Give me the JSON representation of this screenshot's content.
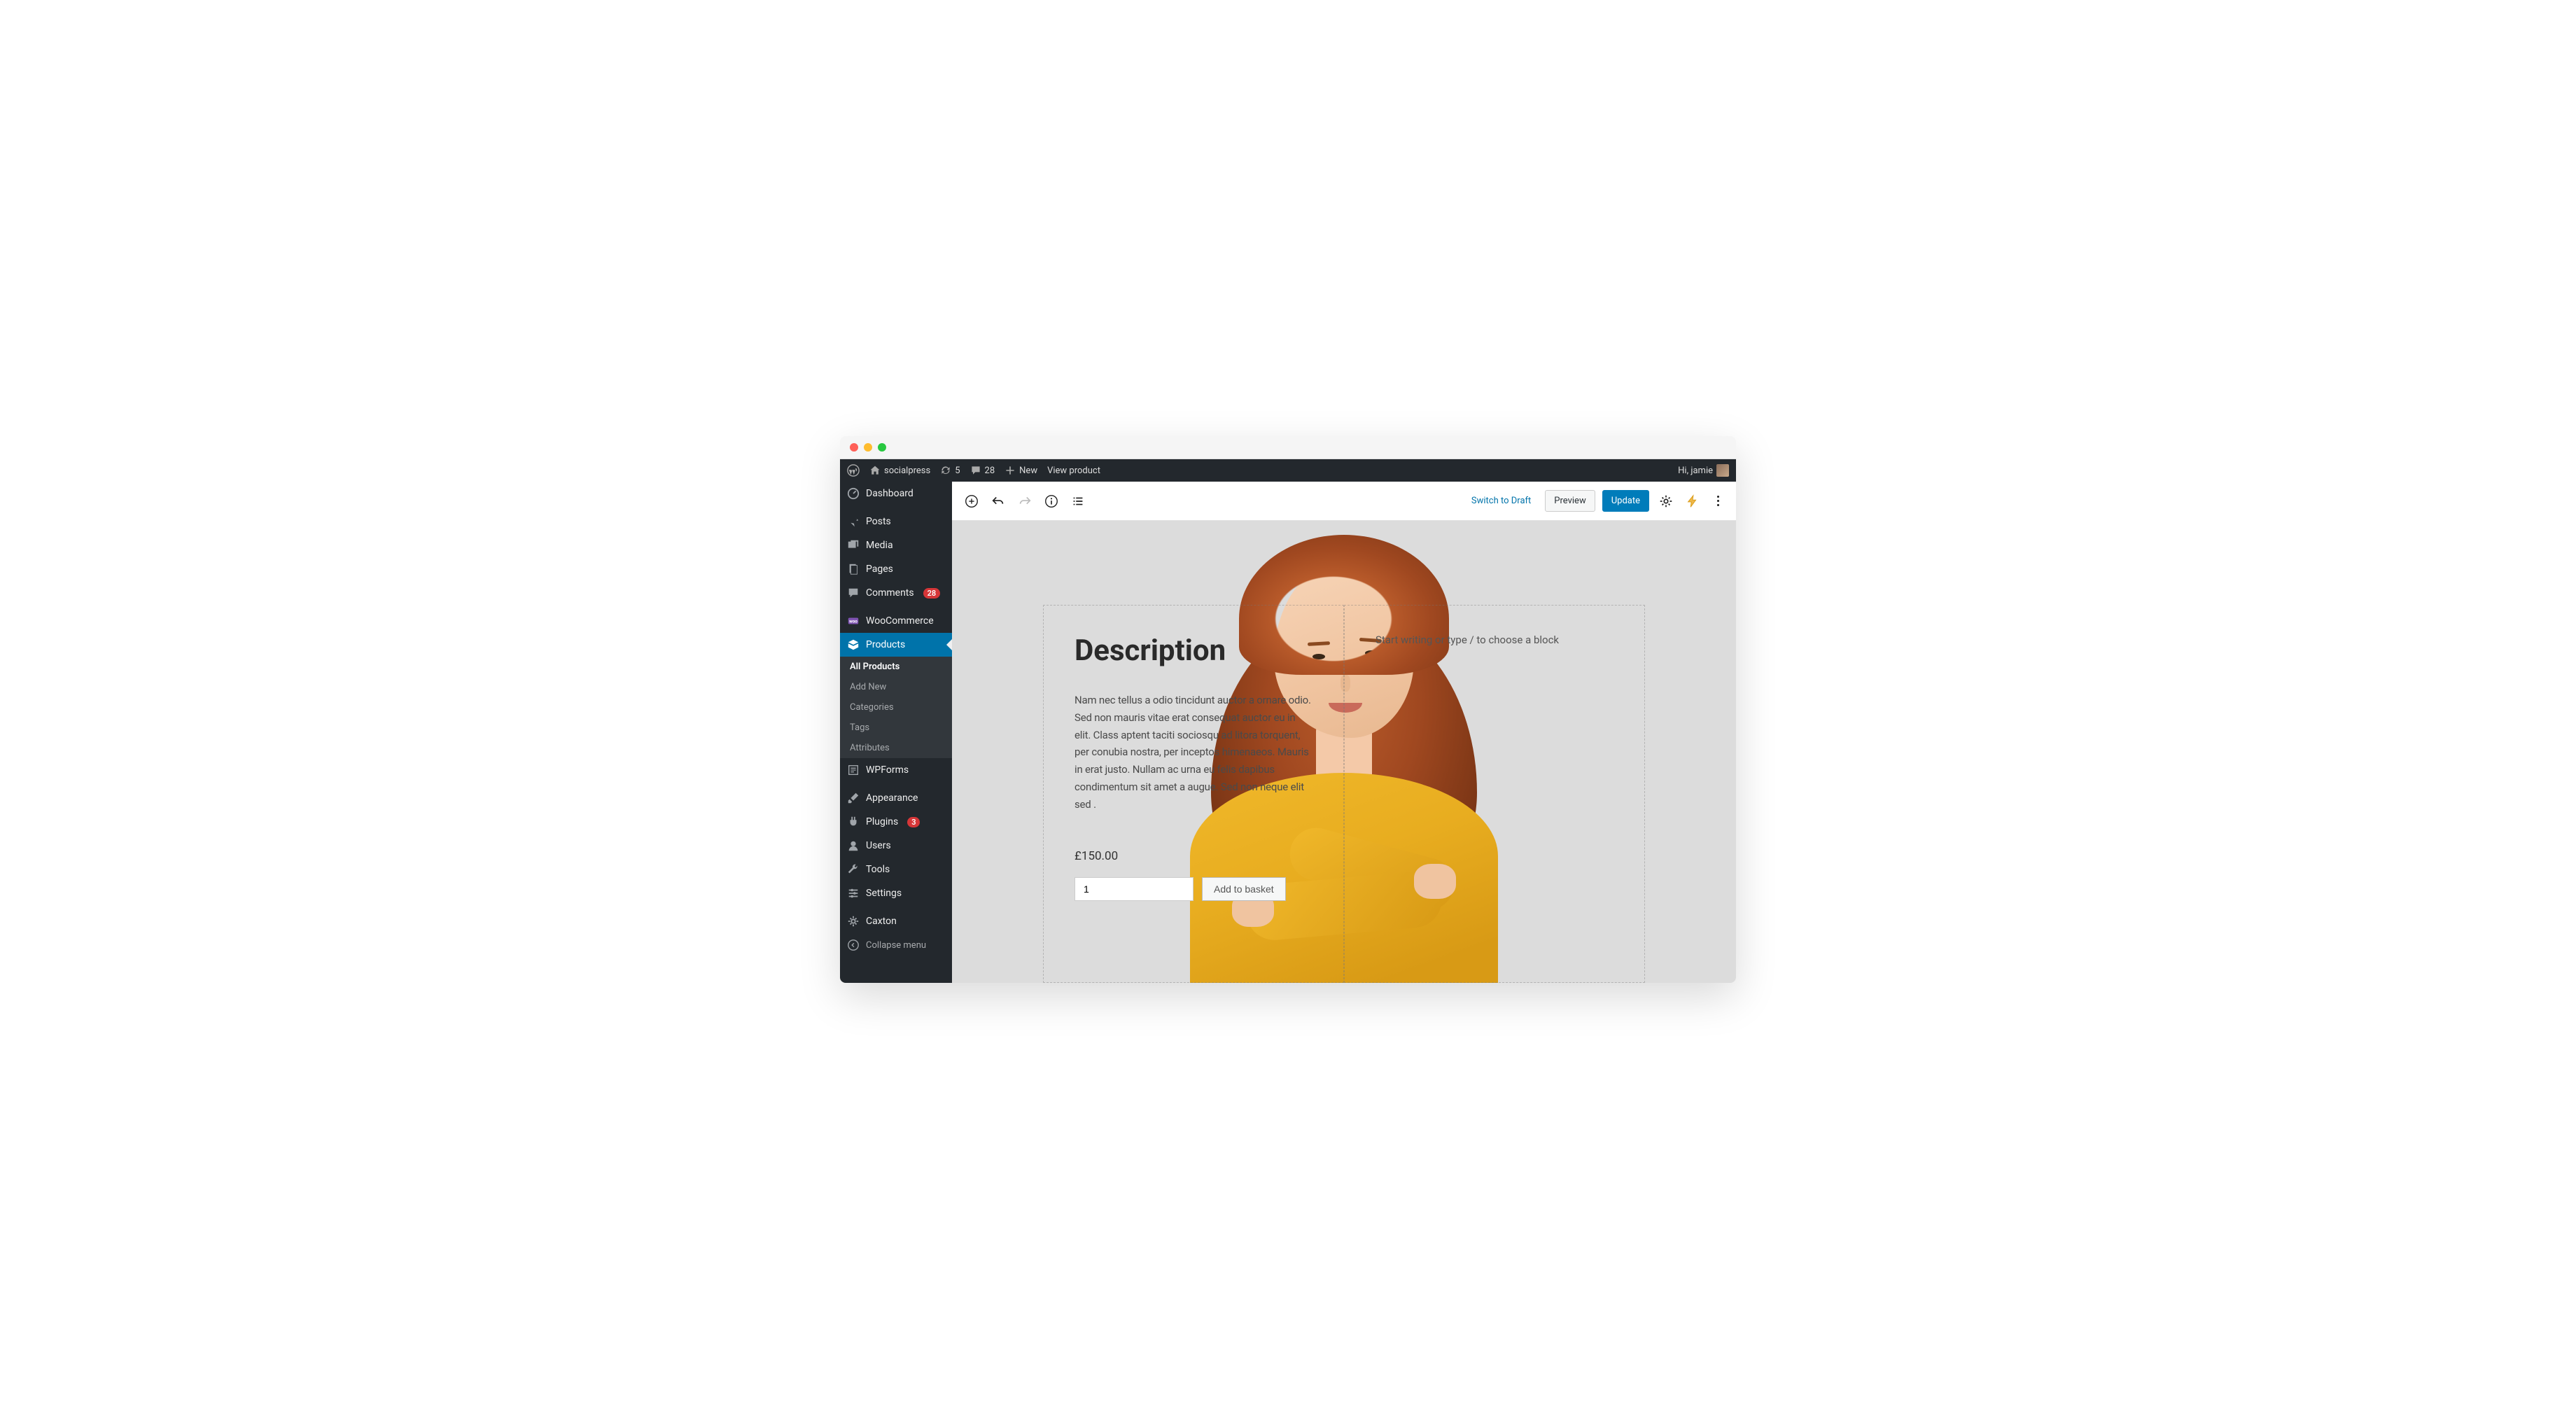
{
  "adminBar": {
    "siteName": "socialpress",
    "updates": "5",
    "comments": "28",
    "newLabel": "New",
    "viewProduct": "View product",
    "greeting": "Hi, jamie"
  },
  "sidebar": {
    "dashboard": "Dashboard",
    "posts": "Posts",
    "media": "Media",
    "pages": "Pages",
    "comments": "Comments",
    "commentsCount": "28",
    "woocommerce": "WooCommerce",
    "products": "Products",
    "submenu": {
      "all": "All Products",
      "addNew": "Add New",
      "categories": "Categories",
      "tags": "Tags",
      "attributes": "Attributes"
    },
    "wpforms": "WPForms",
    "appearance": "Appearance",
    "plugins": "Plugins",
    "pluginsCount": "3",
    "users": "Users",
    "tools": "Tools",
    "settings": "Settings",
    "caxton": "Caxton",
    "collapse": "Collapse menu"
  },
  "editor": {
    "switchDraft": "Switch to Draft",
    "preview": "Preview",
    "update": "Update"
  },
  "product": {
    "descHeading": "Description",
    "descText": "Nam nec tellus a odio tincidunt auctor a ornare odio. Sed non mauris vitae erat consequat auctor eu in elit. Class aptent taciti sociosqu ad litora torquent, per conubia nostra, per inceptos himenaeos. Mauris in erat justo. Nullam ac urna eu felis dapibus condimentum sit amet a augue. Sed non neque elit sed .",
    "price": "£150.00",
    "qty": "1",
    "addToBasket": "Add to basket",
    "placeholder": "Start writing or type / to choose a block"
  }
}
